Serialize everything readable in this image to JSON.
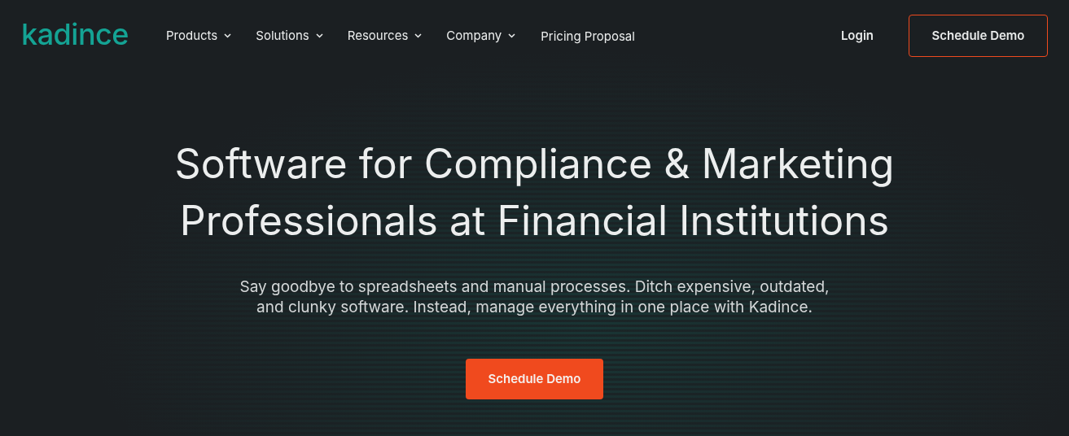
{
  "logo": {
    "text": "kadince"
  },
  "nav": [
    {
      "label": "Products",
      "kind": "dropdown"
    },
    {
      "label": "Solutions",
      "kind": "dropdown"
    },
    {
      "label": "Resources",
      "kind": "dropdown"
    },
    {
      "label": "Company",
      "kind": "dropdown"
    },
    {
      "label": "Pricing Proposal",
      "kind": "link"
    }
  ],
  "header_actions": {
    "login": "Login",
    "cta": "Schedule Demo"
  },
  "hero": {
    "title": "Software for Compliance & Marketing Professionals at Financial Institutions",
    "subtitle": "Say goodbye to spreadsheets and manual processes. Ditch expensive, outdated, and clunky software. Instead, manage everything in one place with Kadince.",
    "cta": "Schedule Demo"
  }
}
